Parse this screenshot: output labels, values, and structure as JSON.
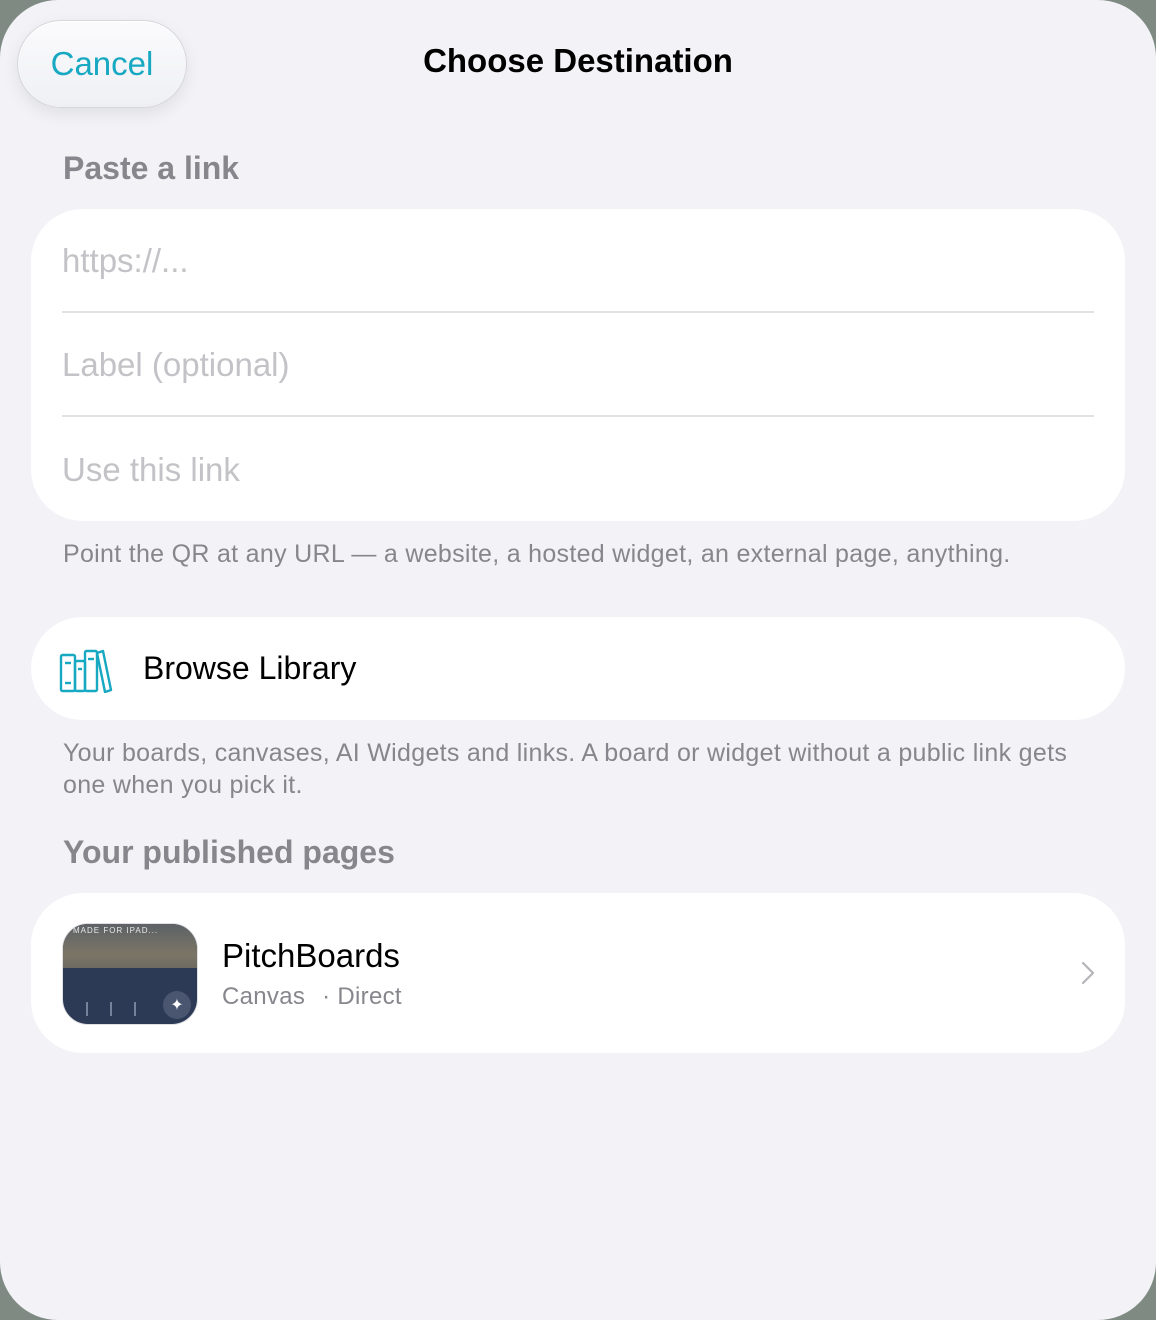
{
  "nav": {
    "cancel_label": "Cancel",
    "title": "Choose Destination"
  },
  "paste_link": {
    "header": "Paste a link",
    "url_placeholder": "https://...",
    "url_value": "",
    "label_placeholder": "Label (optional)",
    "label_value": "",
    "use_link_label": "Use this link",
    "footnote": "Point the QR at any URL — a website, a hosted widget, an external page, anything."
  },
  "browse": {
    "label": "Browse Library",
    "icon": "books-icon",
    "footnote": "Your boards, canvases, AI Widgets and links. A board or widget without a public link gets one when you pick it."
  },
  "published": {
    "header": "Your published pages",
    "items": [
      {
        "title": "PitchBoards",
        "type": "Canvas",
        "mode": "· Direct",
        "thumbnail_text": "MADE FOR IPAD..."
      }
    ]
  },
  "colors": {
    "accent": "#17a8c2",
    "background": "#f2f2f7",
    "card": "#ffffff",
    "secondary_text": "#86868c",
    "placeholder_text": "#c3c3c7"
  }
}
